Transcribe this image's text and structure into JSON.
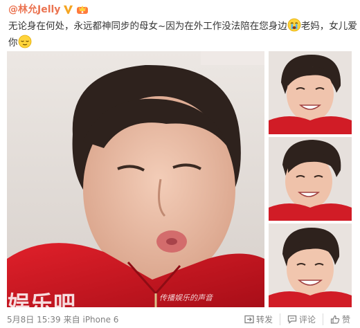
{
  "post": {
    "author": "@林允Jelly",
    "text_part1": "无论身在何处，永远都神同步的母女~因为在外工作没法陪在您身边",
    "text_part2": "老妈，女儿爱你",
    "watermark": "娱乐吧",
    "signature": "传播娱乐的声音",
    "timestamp": "5月8日 15:39",
    "source": "来自 iPhone 6",
    "actions": {
      "repost": "转发",
      "comment": "评论",
      "like": "赞"
    },
    "colors": {
      "username": "#eb7350",
      "verified": "#f5a623",
      "meta": "#808080"
    },
    "icons": [
      "verified-badge-icon",
      "vip-crown-icon",
      "crying-face-icon",
      "relieved-face-icon",
      "repost-icon",
      "comment-icon",
      "like-icon"
    ]
  }
}
